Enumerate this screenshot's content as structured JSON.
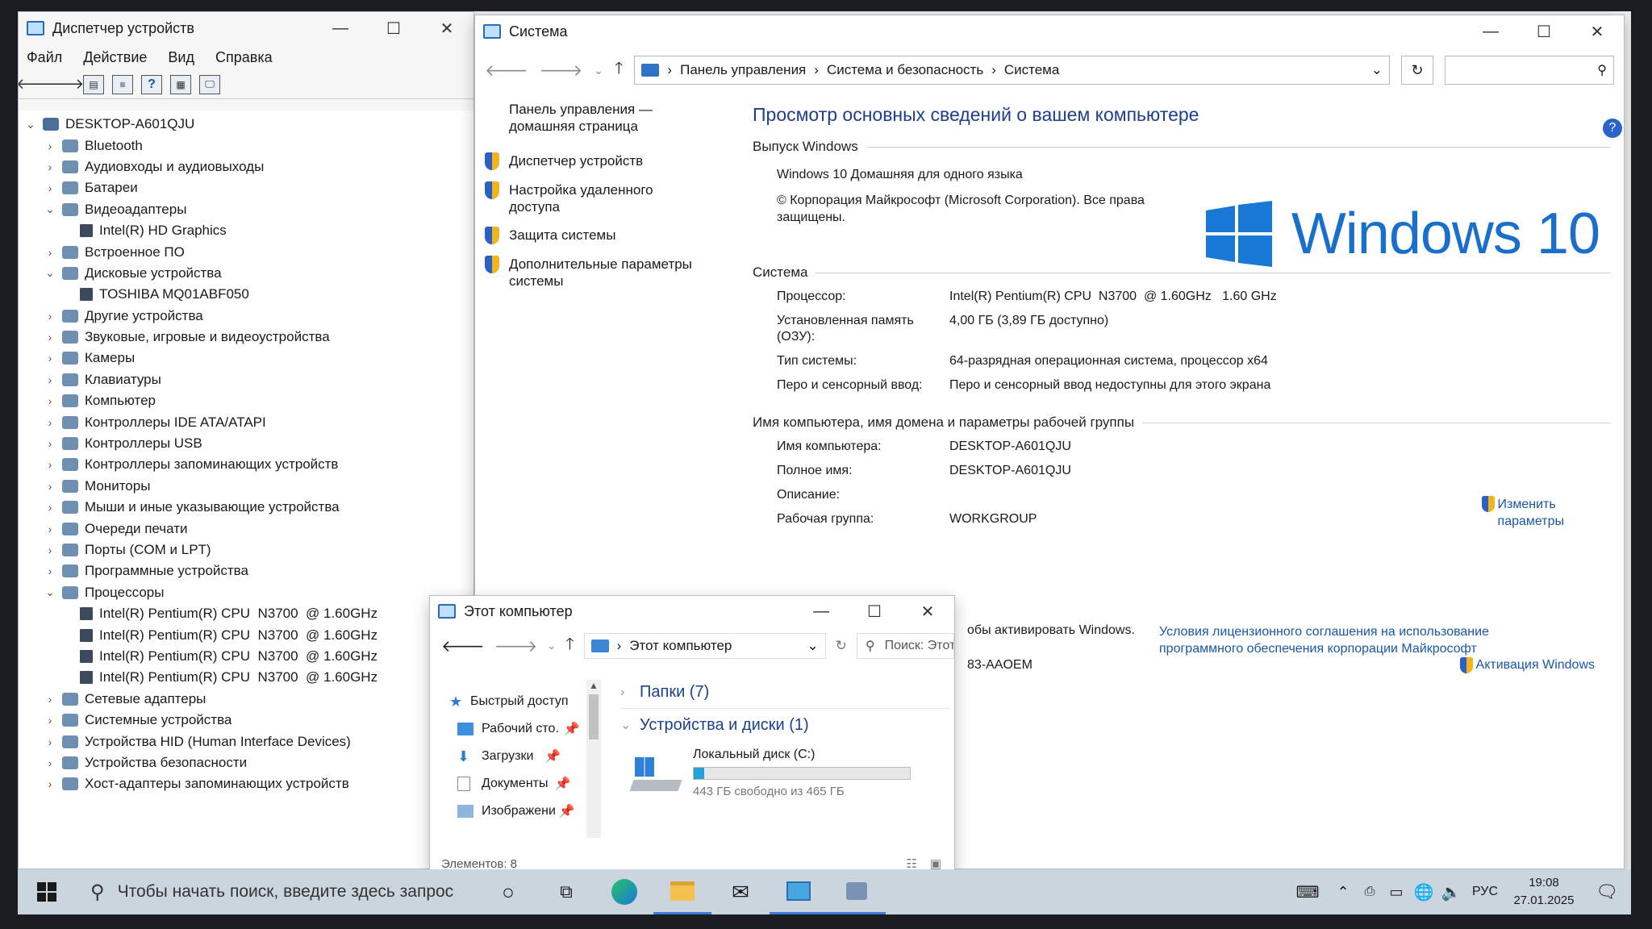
{
  "device_manager": {
    "title": "Диспетчер устройств",
    "menu": [
      "Файл",
      "Действие",
      "Вид",
      "Справка"
    ],
    "root": "DESKTOP-A601QJU",
    "tree": [
      {
        "label": "Bluetooth",
        "depth": 1,
        "expander": "›"
      },
      {
        "label": "Аудиовходы и аудиовыходы",
        "depth": 1,
        "expander": "›"
      },
      {
        "label": "Батареи",
        "depth": 1,
        "expander": "›"
      },
      {
        "label": "Видеоадаптеры",
        "depth": 1,
        "expander": "⌄"
      },
      {
        "label": "Intel(R) HD Graphics",
        "depth": 2,
        "expander": ""
      },
      {
        "label": "Встроенное ПО",
        "depth": 1,
        "expander": "›"
      },
      {
        "label": "Дисковые устройства",
        "depth": 1,
        "expander": "⌄"
      },
      {
        "label": "TOSHIBA MQ01ABF050",
        "depth": 2,
        "expander": ""
      },
      {
        "label": "Другие устройства",
        "depth": 1,
        "expander": "›"
      },
      {
        "label": "Звуковые, игровые и видеоустройства",
        "depth": 1,
        "expander": "›"
      },
      {
        "label": "Камеры",
        "depth": 1,
        "expander": "›"
      },
      {
        "label": "Клавиатуры",
        "depth": 1,
        "expander": "›"
      },
      {
        "label": "Компьютер",
        "depth": 1,
        "expander": "›"
      },
      {
        "label": "Контроллеры IDE ATA/ATAPI",
        "depth": 1,
        "expander": "›"
      },
      {
        "label": "Контроллеры USB",
        "depth": 1,
        "expander": "›"
      },
      {
        "label": "Контроллеры запоминающих устройств",
        "depth": 1,
        "expander": "›"
      },
      {
        "label": "Мониторы",
        "depth": 1,
        "expander": "›"
      },
      {
        "label": "Мыши и иные указывающие устройства",
        "depth": 1,
        "expander": "›"
      },
      {
        "label": "Очереди печати",
        "depth": 1,
        "expander": "›"
      },
      {
        "label": "Порты (COM и LPT)",
        "depth": 1,
        "expander": "›"
      },
      {
        "label": "Программные устройства",
        "depth": 1,
        "expander": "›"
      },
      {
        "label": "Процессоры",
        "depth": 1,
        "expander": "⌄"
      },
      {
        "label": "Intel(R) Pentium(R) CPU  N3700  @ 1.60GHz",
        "depth": 2,
        "expander": ""
      },
      {
        "label": "Intel(R) Pentium(R) CPU  N3700  @ 1.60GHz",
        "depth": 2,
        "expander": ""
      },
      {
        "label": "Intel(R) Pentium(R) CPU  N3700  @ 1.60GHz",
        "depth": 2,
        "expander": ""
      },
      {
        "label": "Intel(R) Pentium(R) CPU  N3700  @ 1.60GHz",
        "depth": 2,
        "expander": ""
      },
      {
        "label": "Сетевые адаптеры",
        "depth": 1,
        "expander": "›"
      },
      {
        "label": "Системные устройства",
        "depth": 1,
        "expander": "›"
      },
      {
        "label": "Устройства HID (Human Interface Devices)",
        "depth": 1,
        "expander": "›"
      },
      {
        "label": "Устройства безопасности",
        "depth": 1,
        "expander": "›"
      },
      {
        "label": "Хост-адаптеры запоминающих устройств",
        "depth": 1,
        "expander": "›"
      }
    ]
  },
  "system": {
    "title": "Система",
    "breadcrumb": [
      "Панель управления",
      "Система и безопасность",
      "Система"
    ],
    "left_home": "Панель управления —\nдомашняя страница",
    "left_links": [
      "Диспетчер устройств",
      "Настройка удаленного\nдоступа",
      "Защита системы",
      "Дополнительные параметры\nсистемы"
    ],
    "heading": "Просмотр основных сведений о вашем компьютере",
    "edition_header": "Выпуск Windows",
    "edition": "Windows 10 Домашняя для одного языка",
    "copyright": "© Корпорация Майкрософт (Microsoft Corporation). Все права\nзащищены.",
    "logo_text": "Windows 10",
    "system_header": "Система",
    "system_rows": [
      {
        "k": "Процессор:",
        "v": "Intel(R) Pentium(R) CPU  N3700  @ 1.60GHz   1.60 GHz"
      },
      {
        "k": "Установленная память\n(ОЗУ):",
        "v": "4,00 ГБ (3,89 ГБ доступно)"
      },
      {
        "k": "Тип системы:",
        "v": "64-разрядная операционная система, процессор x64"
      },
      {
        "k": "Перо и сенсорный ввод:",
        "v": "Перо и сенсорный ввод недоступны для этого экрана"
      }
    ],
    "name_header": "Имя компьютера, имя домена и параметры рабочей группы",
    "name_rows": [
      {
        "k": "Имя компьютера:",
        "v": "DESKTOP-A601QJU"
      },
      {
        "k": "Полное имя:",
        "v": "DESKTOP-A601QJU"
      },
      {
        "k": "Описание:",
        "v": ""
      },
      {
        "k": "Рабочая группа:",
        "v": "WORKGROUP"
      }
    ],
    "change_settings": "Изменить\nпараметры",
    "activation_partial": "обы активировать Windows.",
    "license_link": "Условия лицензионного соглашения на использование\nпрограммного обеспечения корпорации Майкрософт",
    "product_partial": "83-AAOEM",
    "activation_link": "Активация Windows"
  },
  "explorer": {
    "title": "Этот компьютер",
    "address": "Этот компьютер",
    "search_placeholder": "Поиск: Этот",
    "nav_items": [
      "Быстрый доступ",
      "Рабочий сто.",
      "Загрузки",
      "Документы",
      "Изображени"
    ],
    "folders_group": "Папки (7)",
    "devices_group": "Устройства и диски (1)",
    "disk_name": "Локальный диск (C:)",
    "disk_free": "443 ГБ свободно из 465 ГБ",
    "disk_used_fraction": 0.047,
    "status": "Элементов: 8"
  },
  "taskbar": {
    "search_placeholder": "Чтобы начать поиск, введите здесь запрос",
    "lang": "РУС",
    "time": "19:08",
    "date": "27.01.2025"
  }
}
